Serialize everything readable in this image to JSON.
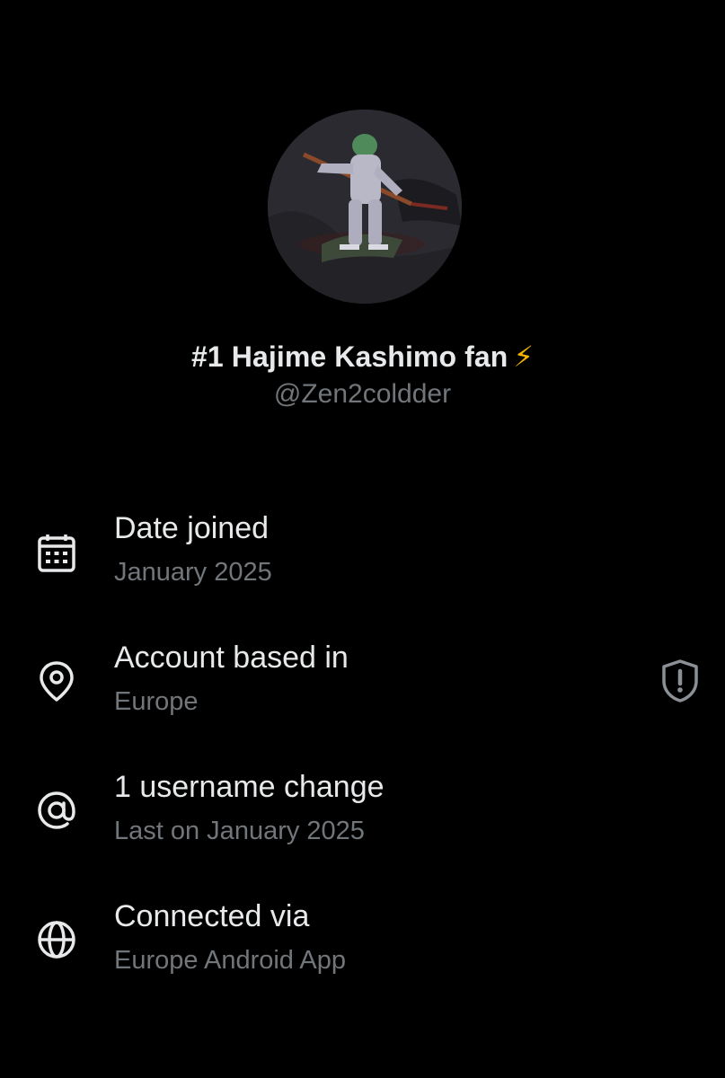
{
  "profile": {
    "display_name": "#1 Hajime Kashimo fan",
    "name_emoji": "⚡",
    "handle": "@Zen2coldder"
  },
  "about": {
    "items": [
      {
        "icon": "calendar-icon",
        "title": "Date joined",
        "subtitle": "January 2025"
      },
      {
        "icon": "location-pin-icon",
        "title": "Account based in",
        "subtitle": "Europe",
        "action_icon": "shield-exclamation-icon"
      },
      {
        "icon": "at-sign-icon",
        "title": "1 username change",
        "subtitle": "Last on January 2025"
      },
      {
        "icon": "globe-icon",
        "title": "Connected via",
        "subtitle": "Europe Android App"
      }
    ]
  },
  "colors": {
    "background": "#000000",
    "primary_text": "#e7e9ea",
    "secondary_text": "#71767b",
    "bolt": "#f4b400"
  }
}
